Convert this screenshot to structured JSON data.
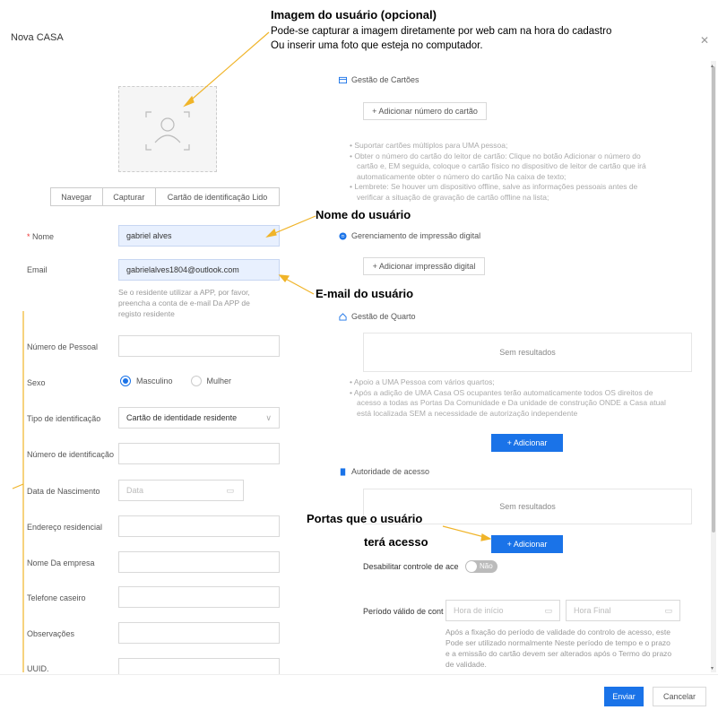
{
  "dialog": {
    "title": "Nova CASA"
  },
  "annotations": {
    "photo": {
      "title": "Imagem do usuário (opcional)",
      "line1": "Pode-se capturar a imagem diretamente por web cam na hora do cadastro",
      "line2": "Ou inserir uma foto que esteja no computador."
    },
    "name": "Nome do usuário",
    "email": "E-mail do usuário",
    "doors_line1": "Portas que o usuário",
    "doors_line2": "terá acesso"
  },
  "photo_buttons": [
    "Navegar",
    "Capturar",
    "Cartão de identificação Lido"
  ],
  "form": {
    "name_label": "Nome",
    "name_value": "gabriel alves",
    "email_label": "Email",
    "email_value": "gabrielalves1804@outlook.com",
    "email_help": [
      "Se o residente utilizar a APP, por favor,",
      "preencha a conta de e-mail Da APP de",
      "registo residente"
    ],
    "person_number_label": "Número de Pessoal",
    "sex_label": "Sexo",
    "sex_options": [
      "Masculino",
      "Mulher"
    ],
    "id_type_label": "Tipo de identificação",
    "id_type_value": "Cartão de identidade residente",
    "id_number_label": "Número de identificação",
    "birth_label": "Data de Nascimento",
    "birth_placeholder": "Data",
    "address_label": "Endereço residencial",
    "company_label": "Nome Da empresa",
    "phone_label": "Telefone caseiro",
    "notes_label": "Observações",
    "uuid_label": "UUID."
  },
  "cards": {
    "title": "Gestão de Cartões",
    "add_button": "+ Adicionar número do cartão",
    "tips": [
      "• Suportar cartões múltiplos para UMA pessoa;",
      "• Obter o número do cartão do leitor de cartão: Clique no botão Adicionar o número do",
      "cartão e, EM seguida, coloque o cartão físico no dispositivo de leitor de cartão que irá",
      "automaticamente obter o número do cartão Na caixa de texto;",
      "• Lembrete: Se houver um dispositivo offline, salve as informações pessoais antes de",
      "verificar a situação de gravação de cartão offline na lista;"
    ]
  },
  "fingerprint": {
    "title": "Gerenciamento de impressão digital",
    "add_button": "+ Adicionar impressão digital"
  },
  "rooms": {
    "title": "Gestão de Quarto",
    "empty": "Sem resultados",
    "tips": [
      "• Apoio a UMA Pessoa com vários quartos;",
      "• Após a adição de UMA Casa OS ocupantes terão automaticamente todos OS direitos de",
      "acesso a todas as Portas Da Comunidade e Da unidade de construção ONDE a Casa atual",
      "está localizada SEM a necessidade de autorização independente"
    ],
    "add_button": "+ Adicionar"
  },
  "access": {
    "title": "Autoridade de acesso",
    "empty": "Sem resultados",
    "add_button": "+ Adicionar",
    "disable_label": "Desabilitar controle de ace",
    "toggle_value": "Não",
    "period_label": "Período válido de cont",
    "start_placeholder": "Hora de início",
    "end_placeholder": "Hora Final",
    "period_help": [
      "Após a fixação do período de validade do controlo de acesso, este",
      "Pode ser utilizado normalmente Neste período de tempo e o prazo",
      "e a emissão do cartão devem ser alterados após o Termo do prazo",
      "de validade."
    ]
  },
  "footer": {
    "submit": "Enviar",
    "cancel": "Cancelar"
  },
  "colors": {
    "accent": "#1a73e8",
    "annotation": "#f0b429"
  }
}
